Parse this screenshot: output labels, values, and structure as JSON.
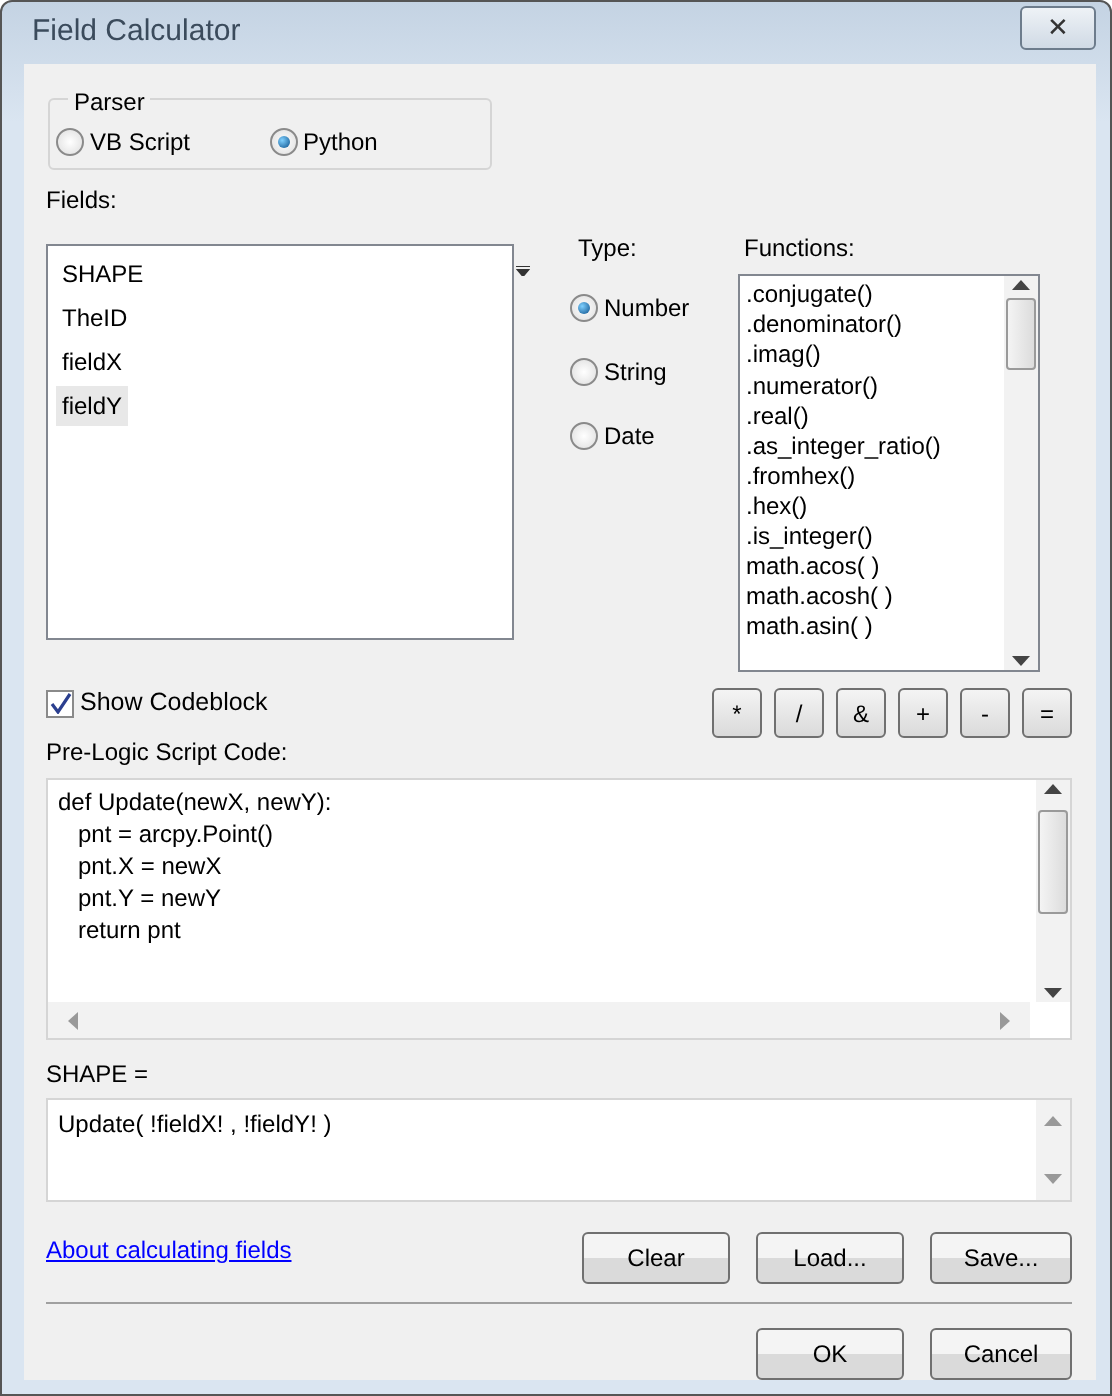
{
  "window": {
    "title": "Field Calculator",
    "close": "✕"
  },
  "parser": {
    "legend": "Parser",
    "options": [
      {
        "label": "VB Script",
        "selected": false
      },
      {
        "label": "Python",
        "selected": true
      }
    ]
  },
  "fields": {
    "label": "Fields:",
    "items": [
      {
        "label": "SHAPE",
        "selected": false
      },
      {
        "label": "TheID",
        "selected": false
      },
      {
        "label": "fieldX",
        "selected": false
      },
      {
        "label": "fieldY",
        "selected": true
      }
    ]
  },
  "type": {
    "label": "Type:",
    "options": [
      {
        "label": "Number",
        "selected": true
      },
      {
        "label": "String",
        "selected": false
      },
      {
        "label": "Date",
        "selected": false
      }
    ]
  },
  "functions": {
    "label": "Functions:",
    "items": [
      ".conjugate()",
      ".denominator()",
      ".imag()",
      ".numerator()",
      ".real()",
      ".as_integer_ratio()",
      ".fromhex()",
      ".hex()",
      ".is_integer()",
      "math.acos( )",
      "math.acosh( )",
      "math.asin( )"
    ]
  },
  "show_codeblock": {
    "label": "Show Codeblock",
    "checked": true
  },
  "operators": [
    "*",
    "/",
    "&",
    "+",
    "-",
    "="
  ],
  "pre_logic": {
    "label": "Pre-Logic Script Code:",
    "lines": [
      "def Update(newX, newY):",
      "   pnt = arcpy.Point()",
      "   pnt.X = newX",
      "   pnt.Y = newY",
      "   return pnt"
    ]
  },
  "expression": {
    "label": "SHAPE =",
    "value": "Update( !fieldX! , !fieldY! )"
  },
  "help_link": "About calculating fields",
  "file_buttons": [
    "Clear",
    "Load...",
    "Save..."
  ],
  "dialog_buttons": [
    "OK",
    "Cancel"
  ]
}
